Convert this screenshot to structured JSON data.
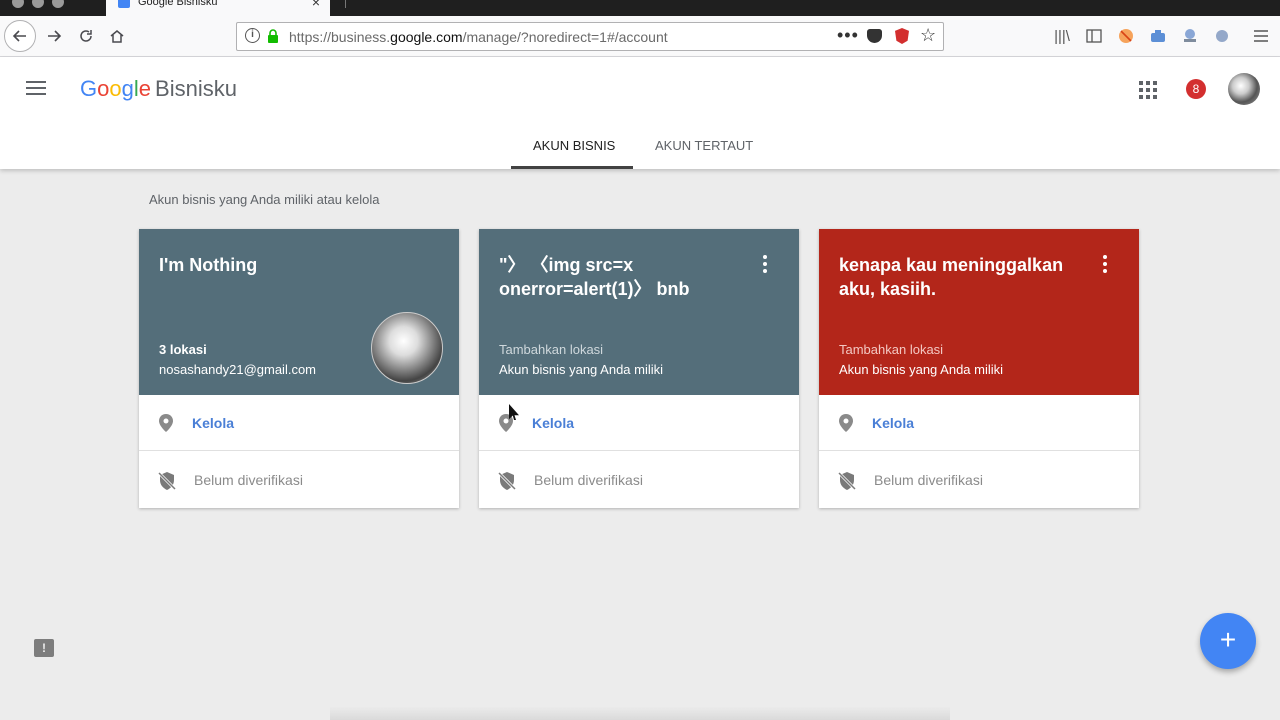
{
  "browser": {
    "tab_title": "Google Bisnisku",
    "url_prefix": "https://business.",
    "url_domain": "google.com",
    "url_suffix": "/manage/?noredirect=1#/account",
    "icons": [
      "back-icon",
      "forward-icon",
      "reload-icon",
      "home-icon",
      "info-icon",
      "lock-icon",
      "page-actions-icon",
      "pocket-icon",
      "angular-extension-icon",
      "bookmark-star-icon",
      "library-icon",
      "sidebar-icon",
      "extension-icon",
      "extension-icon",
      "extension-icon",
      "extension-icon",
      "menu-icon"
    ]
  },
  "app": {
    "logo_text": "Google",
    "logo_colors": [
      "#4285F4",
      "#EA4335",
      "#FBBC05",
      "#4285F4",
      "#34A853",
      "#EA4335"
    ],
    "product_name": "Bisnisku",
    "notification_count": "8"
  },
  "tabs": [
    {
      "label": "AKUN BISNIS",
      "active": true
    },
    {
      "label": "AKUN TERTAUT",
      "active": false
    }
  ],
  "section_label": "Akun bisnis yang Anda miliki atau kelola",
  "cards": [
    {
      "title": "I'm Nothing",
      "line1": "3 lokasi",
      "line2": "nosashandy21@gmail.com",
      "color": "#546e7a",
      "has_menu": false,
      "has_photo": true,
      "manage_label": "Kelola",
      "verify_label": "Belum diverifikasi"
    },
    {
      "title": "\"〉 〈img src=x onerror=alert(1)〉 bnb",
      "line1": "Tambahkan lokasi",
      "line2": "Akun bisnis yang Anda miliki",
      "color": "#546e7a",
      "has_menu": true,
      "has_photo": false,
      "manage_label": "Kelola",
      "verify_label": "Belum diverifikasi"
    },
    {
      "title": "kenapa kau meninggalkan aku, kasiih.",
      "line1": "Tambahkan lokasi",
      "line2": "Akun bisnis yang Anda miliki",
      "color": "#b3261a",
      "has_menu": true,
      "has_photo": false,
      "manage_label": "Kelola",
      "verify_label": "Belum diverifikasi"
    }
  ],
  "fab_label": "+",
  "feedback_label": "!"
}
